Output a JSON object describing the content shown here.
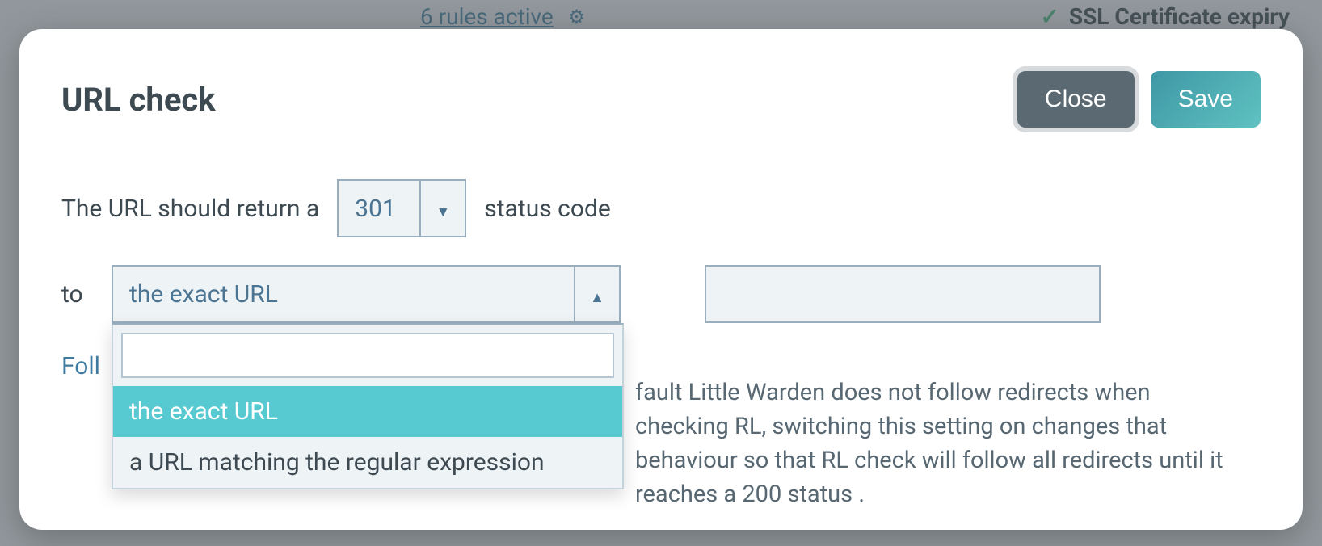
{
  "background": {
    "rules_link": "6 rules active",
    "ssl_item": "SSL Certificate expiry"
  },
  "modal": {
    "title": "URL check",
    "close_label": "Close",
    "save_label": "Save",
    "sentence_prefix": "The URL should return a",
    "status_combo_value": "301",
    "sentence_suffix": "status code",
    "to_label": "to",
    "match_combo_value": "the exact URL",
    "url_input_value": "",
    "dropdown_options": {
      "opt0": "the exact URL",
      "opt1": "a URL matching the regular expression"
    },
    "follow_label": "Foll",
    "follow_desc": "fault Little Warden does not follow redirects when checking RL, switching this setting on changes that behaviour so that RL check will follow all redirects until it reaches a 200 status ."
  }
}
